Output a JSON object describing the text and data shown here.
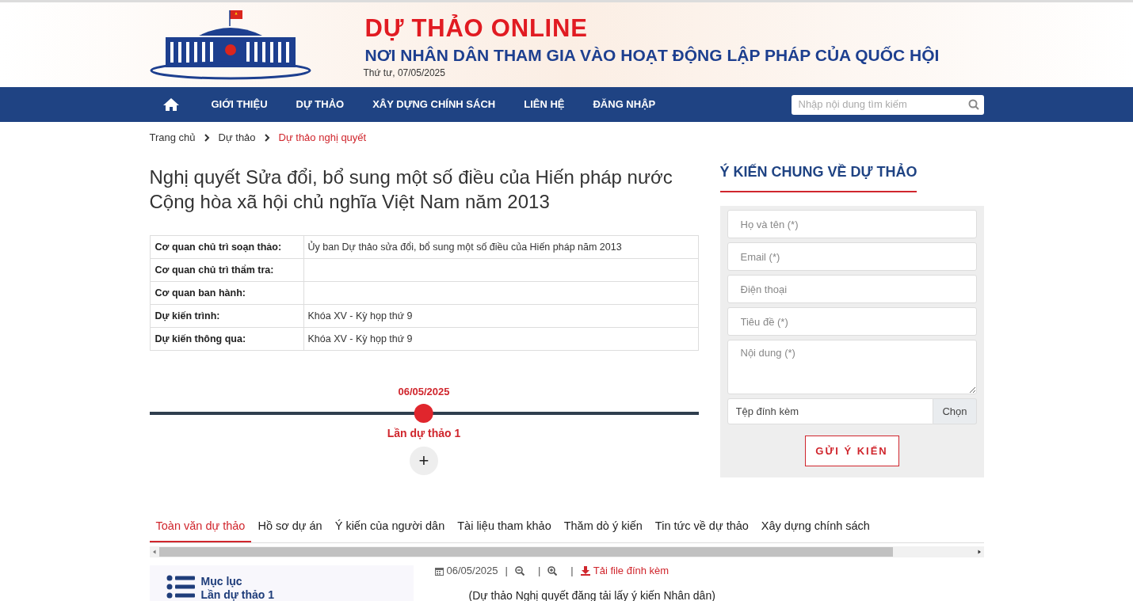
{
  "header": {
    "site_title": "DỰ THẢO ONLINE",
    "tagline": "NƠI NHÂN DÂN THAM GIA VÀO HOẠT ĐỘNG LẬP PHÁP CỦA QUỐC HỘI",
    "date": "Thứ tư, 07/05/2025"
  },
  "nav": {
    "items": [
      {
        "label": "GIỚI THIỆU"
      },
      {
        "label": "DỰ THẢO"
      },
      {
        "label": "XÂY DỰNG CHÍNH SÁCH"
      },
      {
        "label": "LIÊN HỆ"
      },
      {
        "label": "ĐĂNG NHẬP"
      }
    ],
    "search": {
      "placeholder": "Nhập nội dung tìm kiếm"
    }
  },
  "breadcrumb": [
    {
      "label": "Trang chủ",
      "selected": false
    },
    {
      "label": "Dự thảo",
      "selected": false
    },
    {
      "label": "Dự thảo nghị quyết",
      "selected": true
    }
  ],
  "title": "Nghị quyết Sửa đổi, bổ sung một số điều của Hiến pháp nước Cộng hòa xã hội chủ nghĩa Việt Nam năm 2013",
  "info_table": [
    {
      "label": "Cơ quan chủ trì soạn thảo:",
      "value": "Ủy ban Dự thảo sửa đổi, bổ sung một số điều của Hiến pháp năm 2013"
    },
    {
      "label": "Cơ quan chủ trì thẩm tra:"
    },
    {
      "label": "Cơ quan ban hành:"
    },
    {
      "label": "Dự kiến trình:",
      "value": "Khóa XV - Kỳ họp thứ 9"
    },
    {
      "label": "Dự kiến thông qua:",
      "value": "Khóa XV - Kỳ họp thứ 9"
    }
  ],
  "timeline": [
    {
      "date": "06/05/2025",
      "label": "Lần dự thảo 1",
      "selected": true
    }
  ],
  "expand_button": "+",
  "comment_form": {
    "heading": "Ý KIẾN CHUNG VỀ DỰ THẢO",
    "fields": [
      {
        "kind": "input",
        "placeholder": "Họ và tên (*)"
      },
      {
        "kind": "input",
        "placeholder": "Email (*)"
      },
      {
        "kind": "input",
        "placeholder": "Điện thoại"
      },
      {
        "kind": "input",
        "placeholder": "Tiêu đề (*)"
      },
      {
        "kind": "textarea",
        "placeholder": "Nội dung (*)"
      }
    ],
    "attachment": {
      "placeholder": "Tệp đính kèm",
      "button": "Chọn"
    },
    "submit": "GỬI Ý KIẾN"
  },
  "tabs": [
    {
      "label": "Toàn văn dự thảo",
      "selected": true
    },
    {
      "label": "Hồ sơ dự án",
      "selected": false
    },
    {
      "label": "Ý kiến của người dân",
      "selected": false
    },
    {
      "label": "Tài liệu tham khảo",
      "selected": false
    },
    {
      "label": "Thăm dò ý kiến",
      "selected": false
    },
    {
      "label": "Tin tức về dự thảo",
      "selected": false
    },
    {
      "label": "Xây dựng chính sách",
      "selected": false
    }
  ],
  "toc": {
    "title": "Mục lục",
    "subtitle": "Lần dự thảo 1"
  },
  "document": {
    "date": "06/05/2025",
    "separator": "|",
    "download": "Tải file đính kèm",
    "first_line": "(Dự thảo Nghị quyết đăng tải lấy ý kiến Nhân dân)"
  }
}
